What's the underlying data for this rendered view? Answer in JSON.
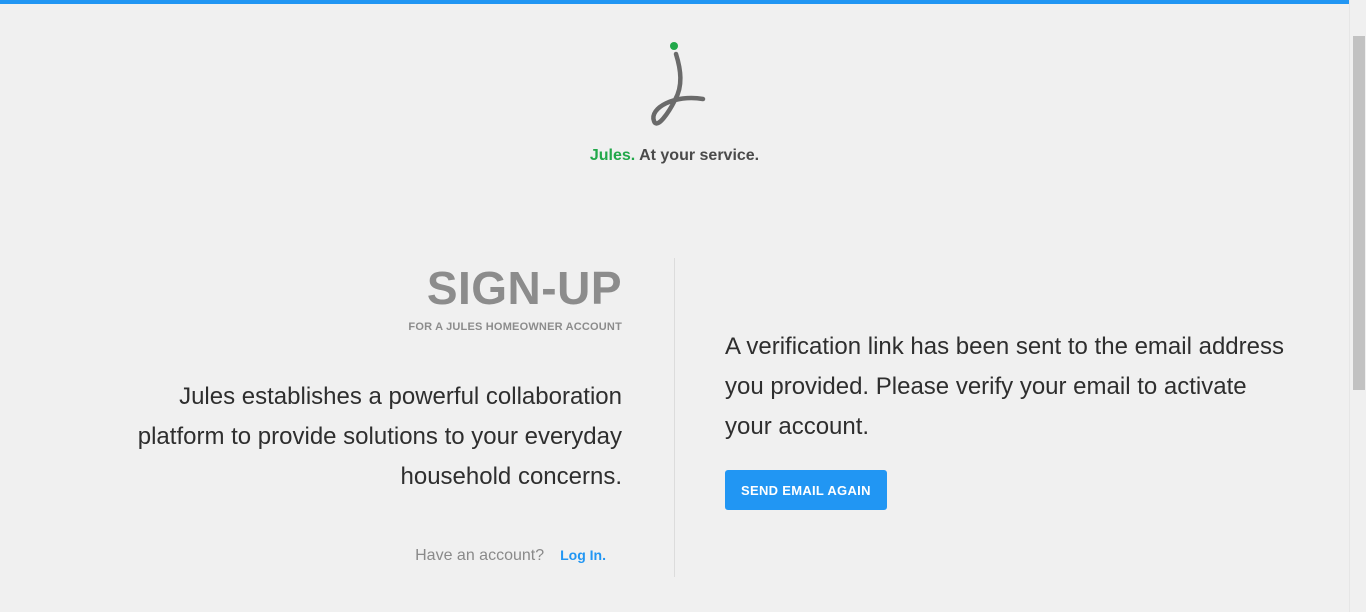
{
  "colors": {
    "accent": "#2196f3",
    "brand_green": "#22a84a",
    "background": "#f0f0f0"
  },
  "header": {
    "logo_icon": "jules-logo-icon",
    "brand_name": "Jules.",
    "tagline": " At your service."
  },
  "signup": {
    "title": "SIGN-UP",
    "subtitle": "FOR A JULES HOMEOWNER ACCOUNT",
    "description": "Jules establishes a powerful collaboration platform to provide solutions to your everyday household concerns.",
    "account_question": "Have an account?",
    "login_link": "Log In."
  },
  "verification": {
    "message": "A verification link has been sent to the email address you provided. Please verify your email to activate your account.",
    "send_again_label": "SEND EMAIL AGAIN"
  }
}
